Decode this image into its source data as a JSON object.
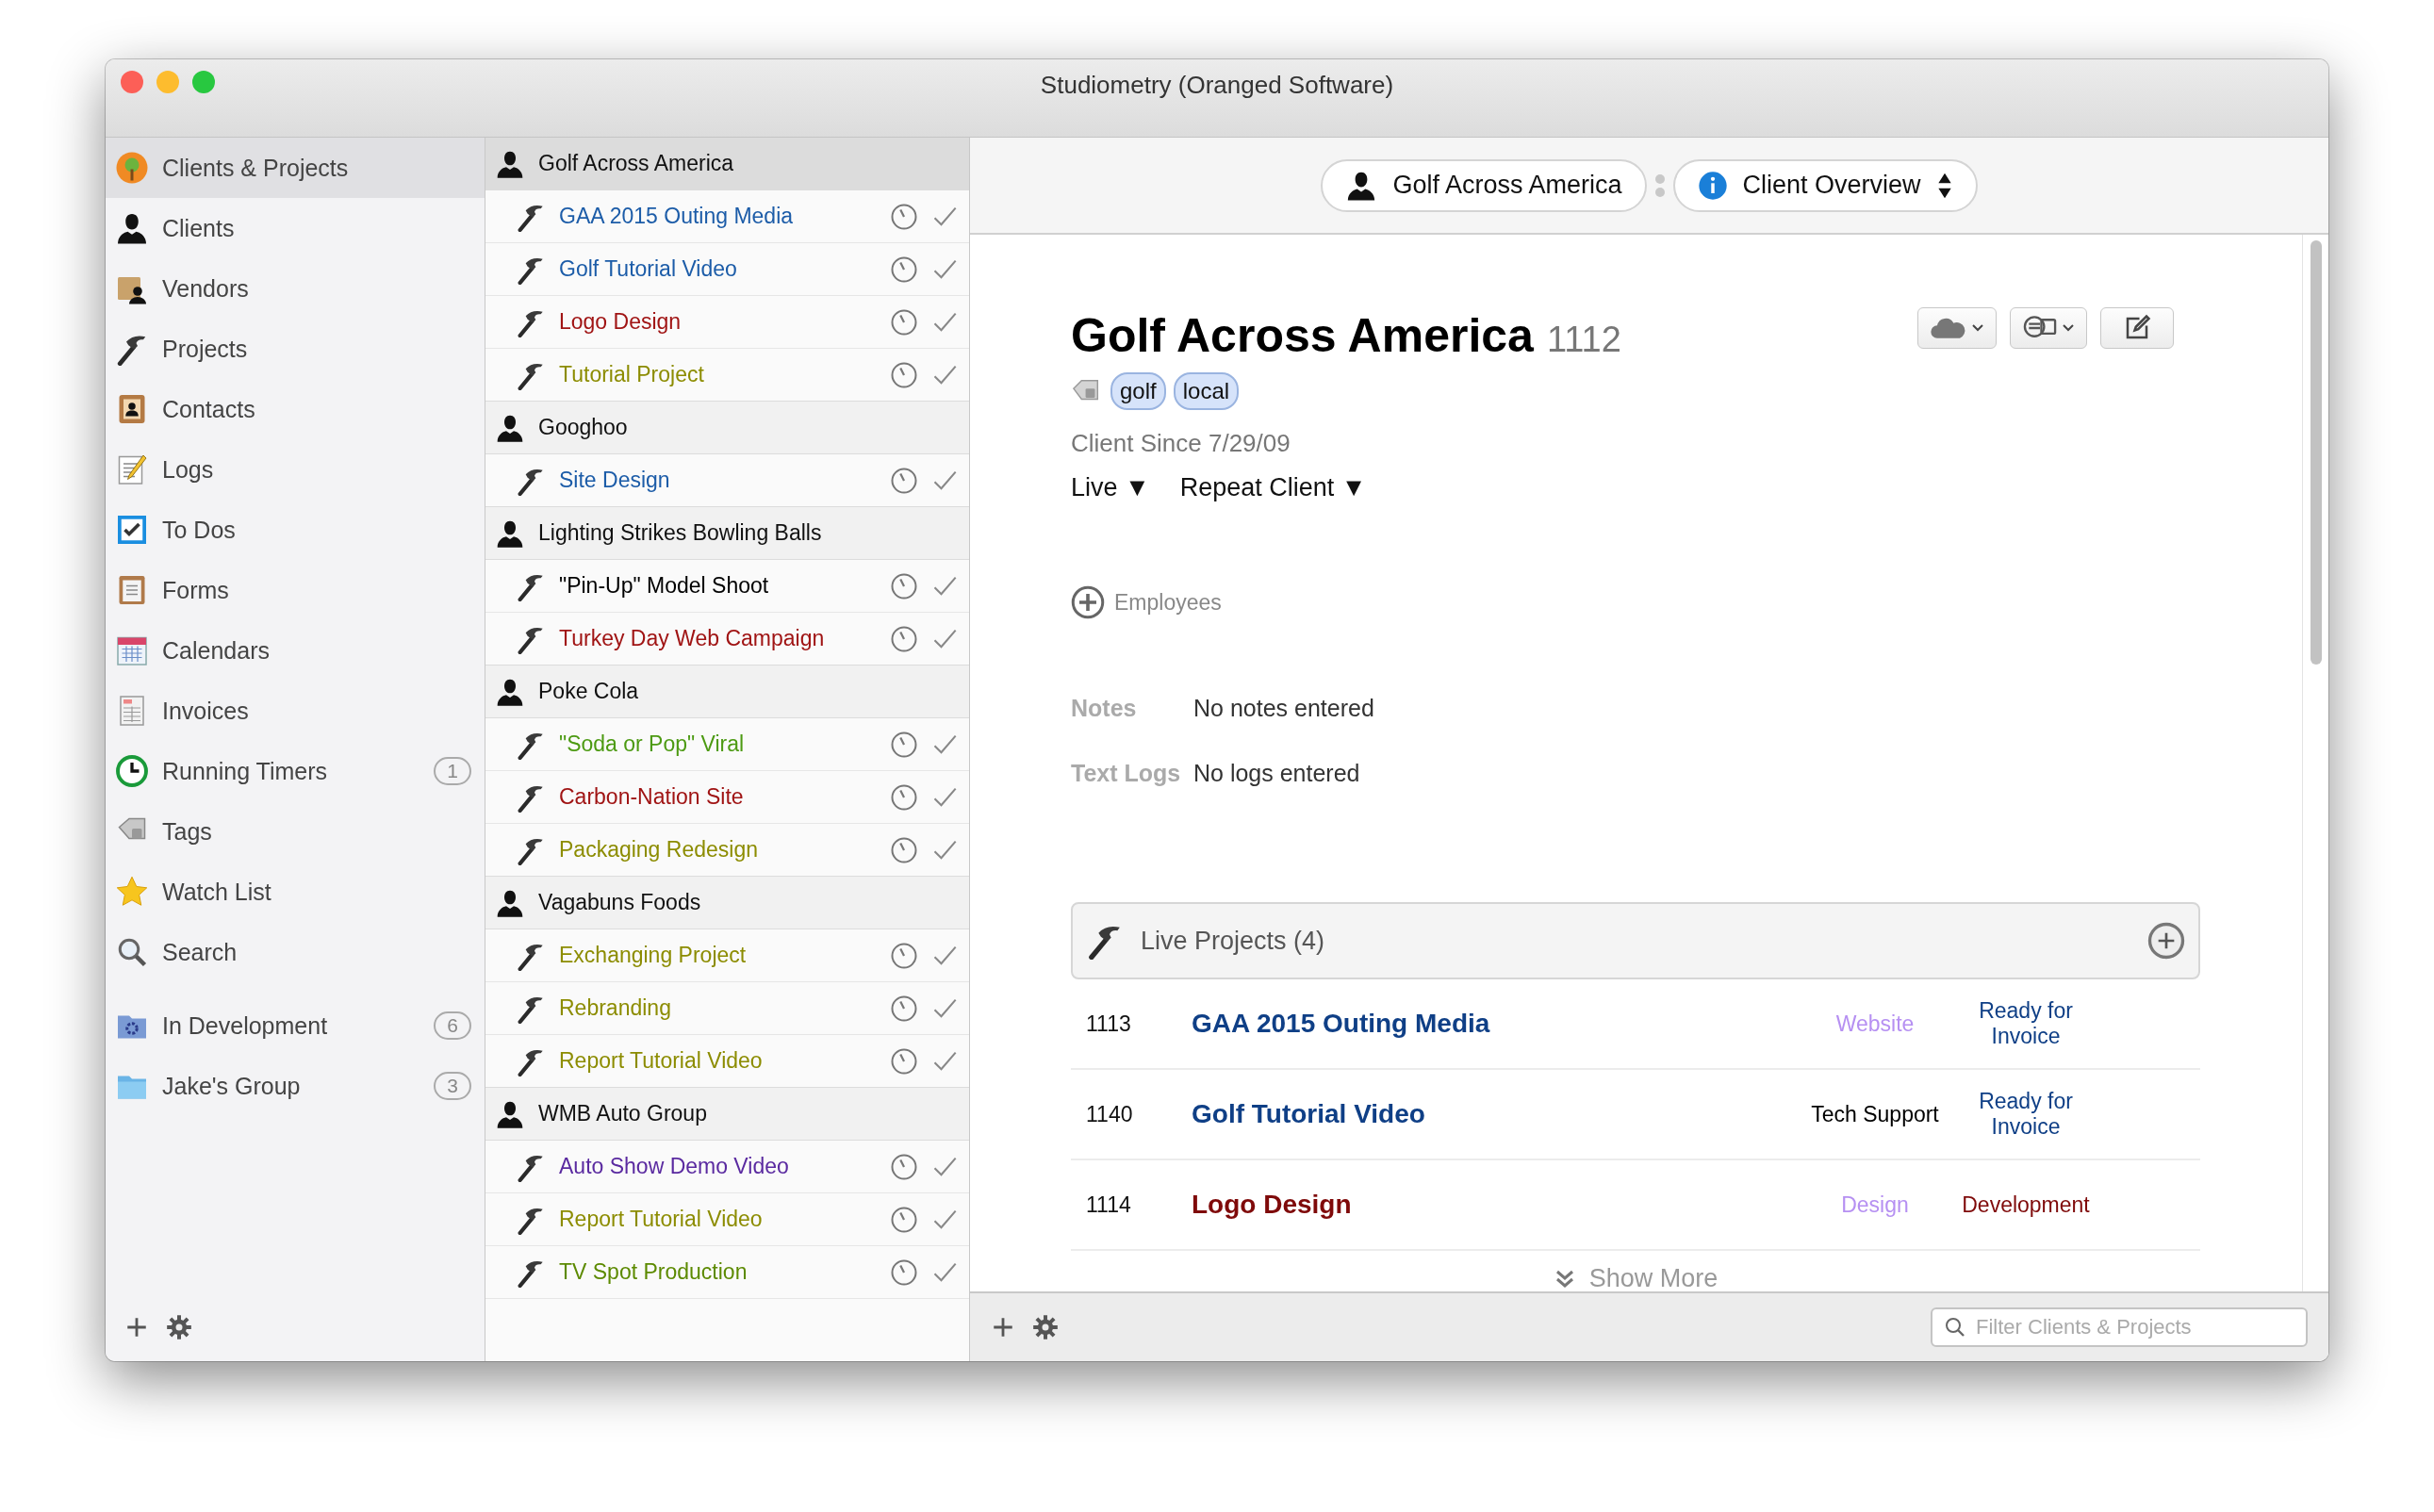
{
  "window": {
    "title": "Studiometry (Oranged Software)"
  },
  "sidebar": {
    "items": [
      {
        "label": "Clients & Projects",
        "selected": true
      },
      {
        "label": "Clients",
        "selected": false
      },
      {
        "label": "Vendors",
        "selected": false
      },
      {
        "label": "Projects",
        "selected": false
      },
      {
        "label": "Contacts",
        "selected": false
      },
      {
        "label": "Logs",
        "selected": false
      },
      {
        "label": "To Dos",
        "selected": false
      },
      {
        "label": "Forms",
        "selected": false
      },
      {
        "label": "Calendars",
        "selected": false
      },
      {
        "label": "Invoices",
        "selected": false
      },
      {
        "label": "Running Timers",
        "selected": false,
        "count": "1"
      },
      {
        "label": "Tags",
        "selected": false
      },
      {
        "label": "Watch List",
        "selected": false
      },
      {
        "label": "Search",
        "selected": false
      }
    ],
    "groups": [
      {
        "label": "In Development",
        "selected": false,
        "count": "6"
      },
      {
        "label": "Jake's Group",
        "selected": false,
        "count": "3"
      }
    ]
  },
  "client_list": [
    {
      "name": "Golf Across America",
      "selected": true,
      "projects": [
        {
          "name": "GAA 2015 Outing Media",
          "color": "#1c5ca8"
        },
        {
          "name": "Golf Tutorial Video",
          "color": "#1c5ca8"
        },
        {
          "name": "Logo Design",
          "color": "#a01414"
        },
        {
          "name": "Tutorial Project",
          "color": "#8c8c00"
        }
      ]
    },
    {
      "name": "Googhoo",
      "selected": false,
      "projects": [
        {
          "name": "Site Design",
          "color": "#1c5ca8"
        }
      ]
    },
    {
      "name": "Lighting Strikes Bowling Balls",
      "selected": false,
      "projects": [
        {
          "name": "\"Pin-Up\" Model Shoot",
          "color": "#000000"
        },
        {
          "name": "Turkey Day Web Campaign",
          "color": "#a01414"
        }
      ]
    },
    {
      "name": "Poke Cola",
      "selected": false,
      "projects": [
        {
          "name": "\"Soda or Pop\" Viral",
          "color": "#4c9a12"
        },
        {
          "name": "Carbon-Nation Site",
          "color": "#a01414"
        },
        {
          "name": "Packaging Redesign",
          "color": "#8c8c00"
        }
      ]
    },
    {
      "name": "Vagabuns Foods",
      "selected": false,
      "projects": [
        {
          "name": "Exchanging Project",
          "color": "#8c8c00"
        },
        {
          "name": "Rebranding",
          "color": "#8c8c00"
        },
        {
          "name": "Report Tutorial Video",
          "color": "#8c8c00"
        }
      ]
    },
    {
      "name": "WMB Auto Group",
      "selected": false,
      "projects": [
        {
          "name": "Auto Show Demo Video",
          "color": "#5a2aa0"
        },
        {
          "name": "Report Tutorial Video",
          "color": "#8c8c00"
        },
        {
          "name": "TV Spot Production",
          "color": "#5c8a00"
        }
      ]
    }
  ],
  "breadcrumb": {
    "client": "Golf Across America",
    "view": "Client Overview"
  },
  "client": {
    "name": "Golf Across America",
    "number": "1112",
    "tags": [
      "golf",
      "local"
    ],
    "since": "Client Since 7/29/09",
    "status": "Live ▼",
    "category": "Repeat Client ▼",
    "employees": "Employees",
    "fields": [
      {
        "label": "Notes",
        "value": "No notes entered"
      },
      {
        "label": "Text Logs",
        "value": "No logs entered"
      }
    ]
  },
  "live_projects": {
    "title": "Live Projects (4)",
    "rows": [
      {
        "number": "1113",
        "name": {
          "text": "GAA 2015 Outing Media",
          "color": "#0f3f86"
        },
        "type": {
          "text": "Website",
          "color": "#b690f2"
        },
        "status": {
          "text": "Ready for Invoice",
          "color": "#0f3f86"
        }
      },
      {
        "number": "1140",
        "name": {
          "text": "Golf Tutorial Video",
          "color": "#0f3f86"
        },
        "type": {
          "text": "Tech Support",
          "color": "#000000"
        },
        "status": {
          "text": "Ready for Invoice",
          "color": "#0f3f86"
        }
      },
      {
        "number": "1114",
        "name": {
          "text": "Logo Design",
          "color": "#7f0a0a"
        },
        "type": {
          "text": "Design",
          "color": "#b690f2"
        },
        "status": {
          "text": "Development",
          "color": "#7f0a0a"
        }
      }
    ],
    "show_more": "Show More"
  },
  "filter": {
    "placeholder": "Filter Clients & Projects"
  }
}
